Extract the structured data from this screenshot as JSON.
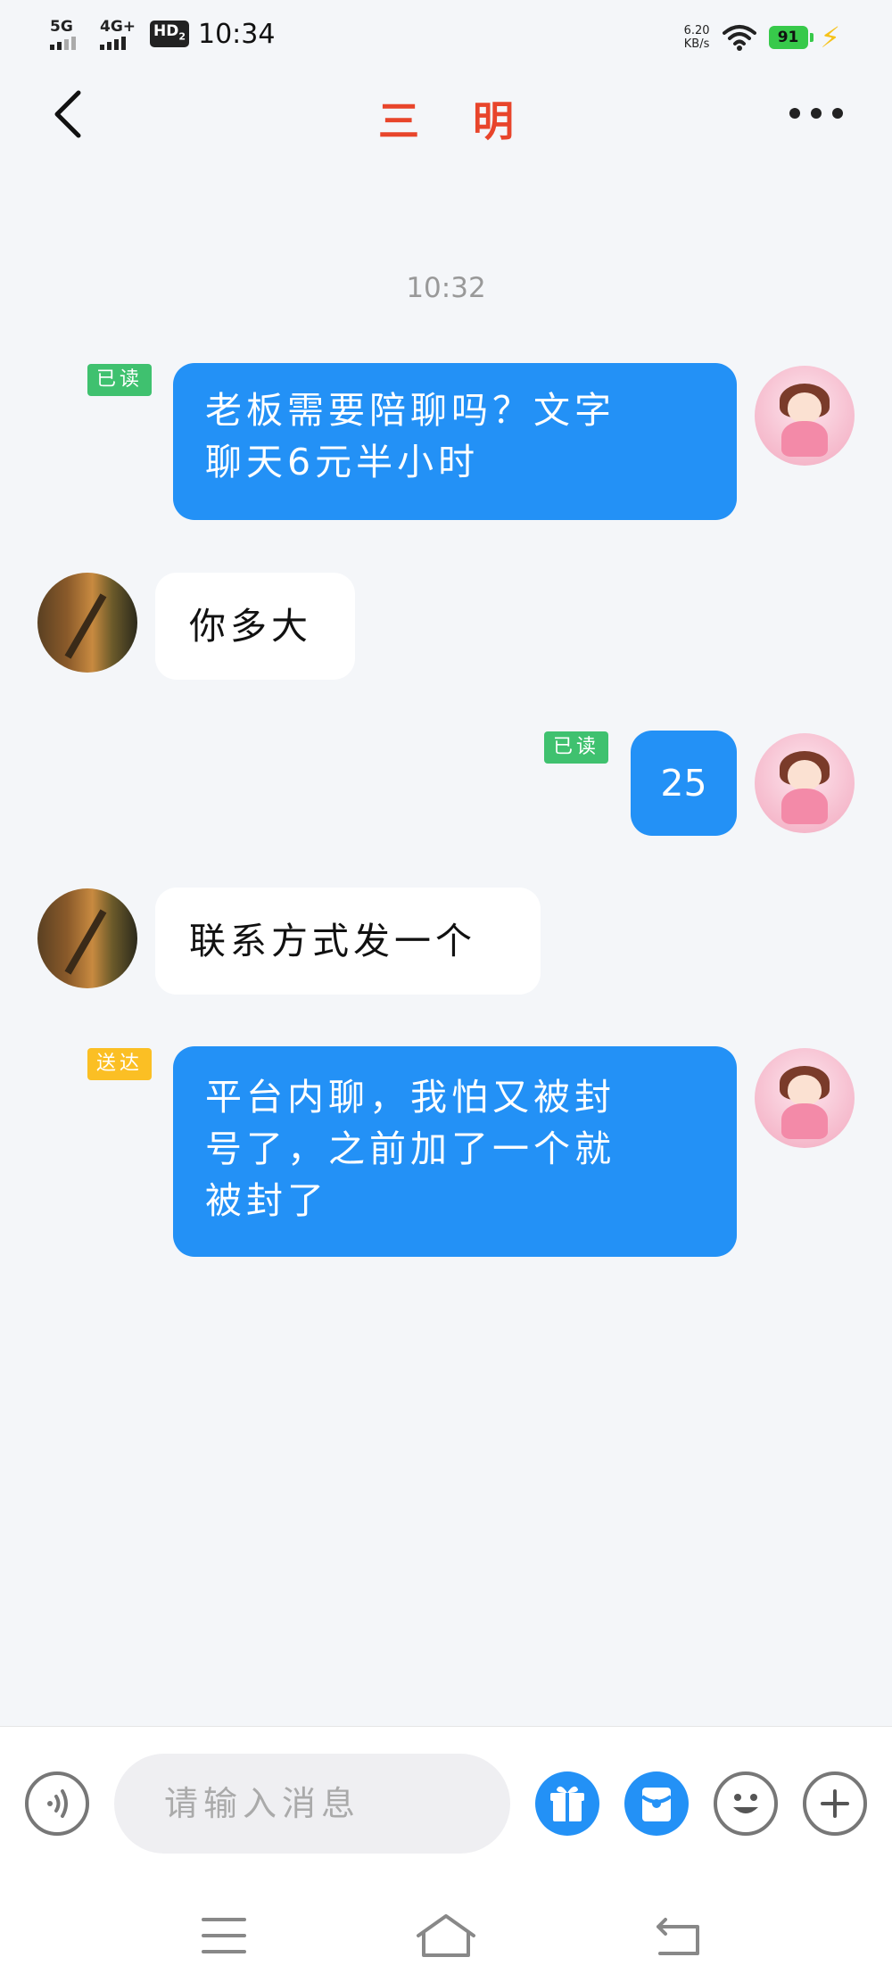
{
  "status_bar": {
    "signal1_label": "5G",
    "signal2_label": "4G+",
    "hd_label": "HD",
    "hd_sub": "2",
    "time": "10:34",
    "net_speed_value": "6.20",
    "net_speed_unit": "KB/s",
    "battery_level": "91",
    "icons": [
      "signal-icon",
      "wifi-icon",
      "battery-icon",
      "charging-icon"
    ]
  },
  "header": {
    "title": "三 明",
    "back_icon": "chevron-left-icon",
    "more_icon": "more-dots-icon"
  },
  "chat": {
    "time_separator": "10:32",
    "messages": [
      {
        "direction": "out",
        "status": "已读",
        "text_lines": [
          "老板需要陪聊吗？文字",
          "聊天6元半小时"
        ]
      },
      {
        "direction": "in",
        "text_lines": [
          "你多大"
        ]
      },
      {
        "direction": "out",
        "status": "已读",
        "text_lines": [
          "25"
        ]
      },
      {
        "direction": "in",
        "text_lines": [
          "联系方式发一个"
        ]
      },
      {
        "direction": "out",
        "status": "送达",
        "text_lines": [
          "平台内聊，我怕又被封",
          "号了，之前加了一个就",
          "被封了"
        ]
      }
    ]
  },
  "input_bar": {
    "placeholder": "请输入消息",
    "icons": [
      "voice-icon",
      "gift-icon",
      "red-packet-icon",
      "emoji-icon",
      "plus-icon"
    ]
  },
  "nav_bar": {
    "icons": [
      "menu-icon",
      "home-icon",
      "back-icon"
    ]
  },
  "colors": {
    "accent_blue": "#2391f6",
    "title_red": "#e8452b",
    "read_green": "#3fc16f",
    "delivered_yellow": "#fbbf24",
    "battery_green": "#37c94a"
  }
}
